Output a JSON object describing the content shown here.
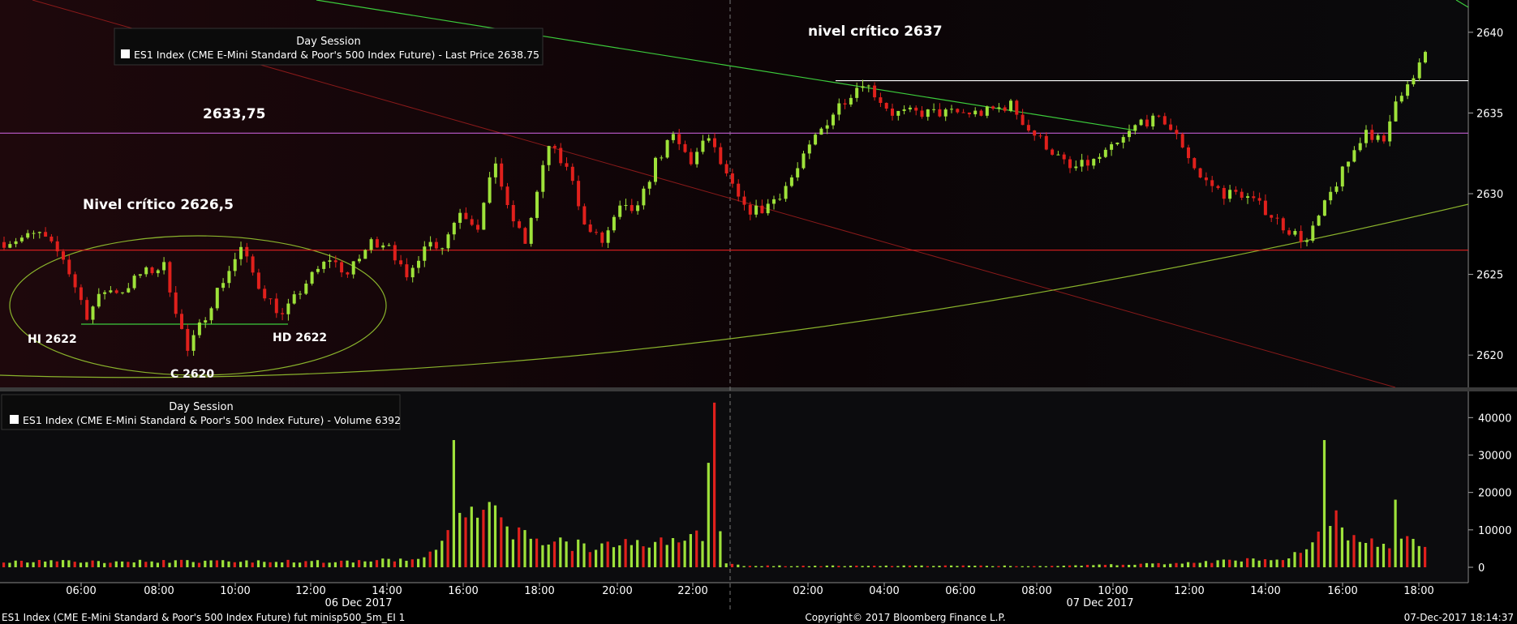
{
  "chart_data": {
    "type": "candlestick",
    "price_panel": {
      "legend": {
        "session": "Day Session",
        "series": "ES1 Index (CME E-Mini Standard & Poor's 500 Index Future) - Last Price 2638.75"
      },
      "ylim": [
        2618,
        2642
      ],
      "y_ticks": [
        "2620",
        "2625",
        "2630",
        "2635",
        "2640"
      ],
      "levels": [
        {
          "value": 2637,
          "color": "#ffffff"
        },
        {
          "value": 2633.75,
          "color": "#c05cd0"
        },
        {
          "value": 2626.5,
          "color": "#e02020"
        }
      ],
      "annotations": [
        {
          "text": "nivel crítico 2637"
        },
        {
          "text": "2633,75"
        },
        {
          "text": "Nivel crítico 2626,5"
        },
        {
          "text": "HI 2622"
        },
        {
          "text": "HD 2622"
        },
        {
          "text": "C 2620"
        }
      ]
    },
    "volume_panel": {
      "legend": {
        "session": "Day Session",
        "series": "ES1 Index (CME E-Mini Standard & Poor's 500 Index Future) - Volume 6392"
      },
      "ylim": [
        0,
        47000
      ],
      "y_ticks": [
        "0",
        "10000",
        "20000",
        "30000",
        "40000"
      ]
    },
    "x_ticks": [
      "06:00",
      "08:00",
      "10:00",
      "12:00",
      "14:00",
      "16:00",
      "18:00",
      "20:00",
      "22:00",
      "02:00",
      "04:00",
      "06:00",
      "08:00",
      "10:00",
      "12:00",
      "14:00",
      "16:00",
      "18:00"
    ],
    "x_dates": [
      "06 Dec 2017",
      "07 Dec 2017"
    ],
    "up_color": "#9ee23a",
    "down_color": "#e0201c",
    "ohlc_anchors": [
      [
        0,
        2627
      ],
      [
        6,
        2627.5
      ],
      [
        10,
        2626
      ],
      [
        14,
        2622.5
      ],
      [
        17,
        2624
      ],
      [
        20,
        2624
      ],
      [
        23,
        2625
      ],
      [
        27,
        2625.5
      ],
      [
        31,
        2620.2
      ],
      [
        34,
        2622.5
      ],
      [
        36,
        2624
      ],
      [
        40,
        2626.6
      ],
      [
        43,
        2624.3
      ],
      [
        47,
        2622.4
      ],
      [
        51,
        2624.5
      ],
      [
        55,
        2626
      ],
      [
        58,
        2625
      ],
      [
        62,
        2627
      ],
      [
        65,
        2627
      ],
      [
        68,
        2624.5
      ],
      [
        71,
        2627
      ],
      [
        74,
        2626.8
      ],
      [
        77,
        2629
      ],
      [
        80,
        2628
      ],
      [
        83,
        2632
      ],
      [
        85,
        2629
      ],
      [
        88,
        2627
      ],
      [
        92,
        2633
      ],
      [
        96,
        2631
      ],
      [
        98,
        2628
      ],
      [
        101,
        2627
      ],
      [
        104,
        2629
      ],
      [
        107,
        2629
      ],
      [
        110,
        2632
      ],
      [
        113,
        2633.5
      ],
      [
        116,
        2632
      ],
      [
        119,
        2633.5
      ],
      [
        122,
        2631
      ],
      [
        125,
        2629
      ],
      [
        128,
        2629
      ],
      [
        131,
        2630
      ],
      [
        134,
        2631.5
      ],
      [
        137,
        2633.5
      ],
      [
        141,
        2635.5
      ],
      [
        145,
        2637
      ],
      [
        150,
        2635
      ],
      [
        155,
        2635
      ],
      [
        160,
        2635
      ],
      [
        165,
        2635
      ],
      [
        170,
        2635.5
      ],
      [
        173,
        2634
      ],
      [
        176,
        2633
      ],
      [
        180,
        2631.5
      ],
      [
        184,
        2632
      ],
      [
        188,
        2633
      ],
      [
        192,
        2634.5
      ],
      [
        196,
        2634.5
      ],
      [
        199,
        2633
      ],
      [
        202,
        2631
      ],
      [
        206,
        2630
      ],
      [
        209,
        2630
      ],
      [
        213,
        2629
      ],
      [
        216,
        2628
      ],
      [
        220,
        2627
      ],
      [
        224,
        2630
      ],
      [
        227,
        2632
      ],
      [
        230,
        2634
      ],
      [
        233,
        2633
      ],
      [
        235,
        2636
      ],
      [
        238,
        2637
      ],
      [
        240,
        2638.75
      ]
    ],
    "volume_anchors": [
      [
        0,
        2000
      ],
      [
        60,
        2000
      ],
      [
        70,
        3000
      ],
      [
        75,
        10000
      ],
      [
        76,
        34000
      ],
      [
        77,
        22000
      ],
      [
        80,
        14000
      ],
      [
        83,
        22000
      ],
      [
        86,
        12000
      ],
      [
        90,
        9000
      ],
      [
        100,
        7000
      ],
      [
        110,
        9000
      ],
      [
        115,
        10000
      ],
      [
        118,
        12000
      ],
      [
        120,
        44000
      ],
      [
        121,
        10000
      ],
      [
        122,
        1500
      ],
      [
        125,
        500
      ],
      [
        180,
        500
      ],
      [
        200,
        1500
      ],
      [
        215,
        3000
      ],
      [
        220,
        5000
      ],
      [
        222,
        10000
      ],
      [
        223,
        34000
      ],
      [
        224,
        20000
      ],
      [
        225,
        26000
      ],
      [
        226,
        12000
      ],
      [
        230,
        10000
      ],
      [
        234,
        6000
      ],
      [
        235,
        23000
      ],
      [
        236,
        8000
      ],
      [
        238,
        10000
      ],
      [
        240,
        6392
      ]
    ]
  },
  "footer": {
    "left": "ES1 Index (CME E-Mini Standard & Poor's 500 Index Future) fut minisp500_5m_EI 1",
    "center": "Copyright© 2017 Bloomberg Finance L.P.",
    "right": "07-Dec-2017 18:14:37"
  }
}
